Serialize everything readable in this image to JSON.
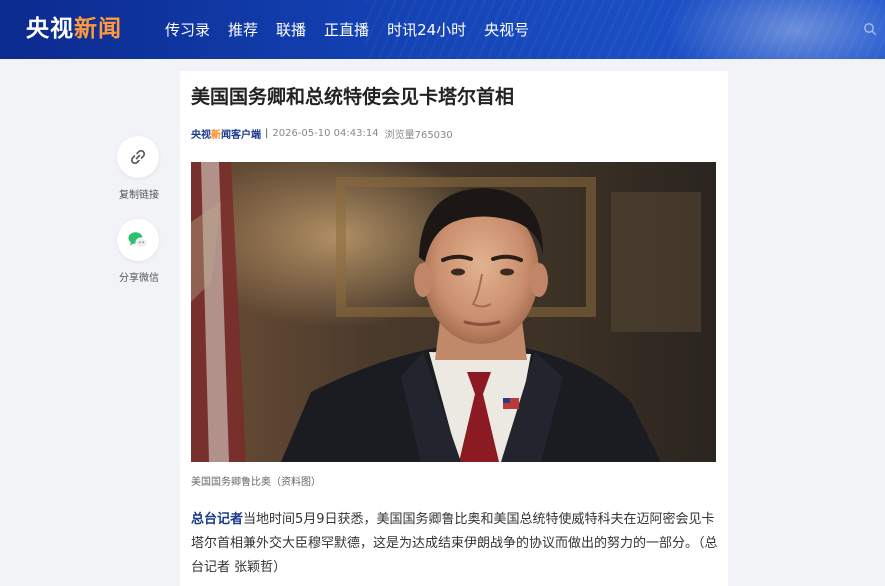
{
  "header": {
    "logo_main": "央视",
    "logo_accent": "新闻",
    "nav": [
      "传习录",
      "推荐",
      "联播",
      "正直播",
      "时讯24小时",
      "央视号"
    ]
  },
  "side": {
    "copy_label": "复制链接",
    "share_label": "分享微信"
  },
  "article": {
    "title": "美国国务卿和总统特使会见卡塔尔首相",
    "source_main": "央视",
    "source_accent": "新",
    "source_rest": "闻客户端",
    "separator": "|",
    "time": "2026-05-10 04:43:14",
    "views": "浏览量765030",
    "caption": "美国国务卿鲁比奥（资料图）",
    "lead": "总台记者",
    "body": "当地时间5月9日获悉，美国国务卿鲁比奥和美国总统特使威特科夫在迈阿密会见卡塔尔首相兼外交大臣穆罕默德，这是为达成结束伊朗战争的协议而做出的努力的一部分。（总台记者 张颖哲）"
  },
  "colors": {
    "header_bg": "#1240b0",
    "logo_accent": "#ff9a3c",
    "source_color": "#1b3a8a",
    "page_bg": "#f2f3f7"
  },
  "icons": {
    "copy": "link-icon",
    "share": "wechat-icon"
  }
}
